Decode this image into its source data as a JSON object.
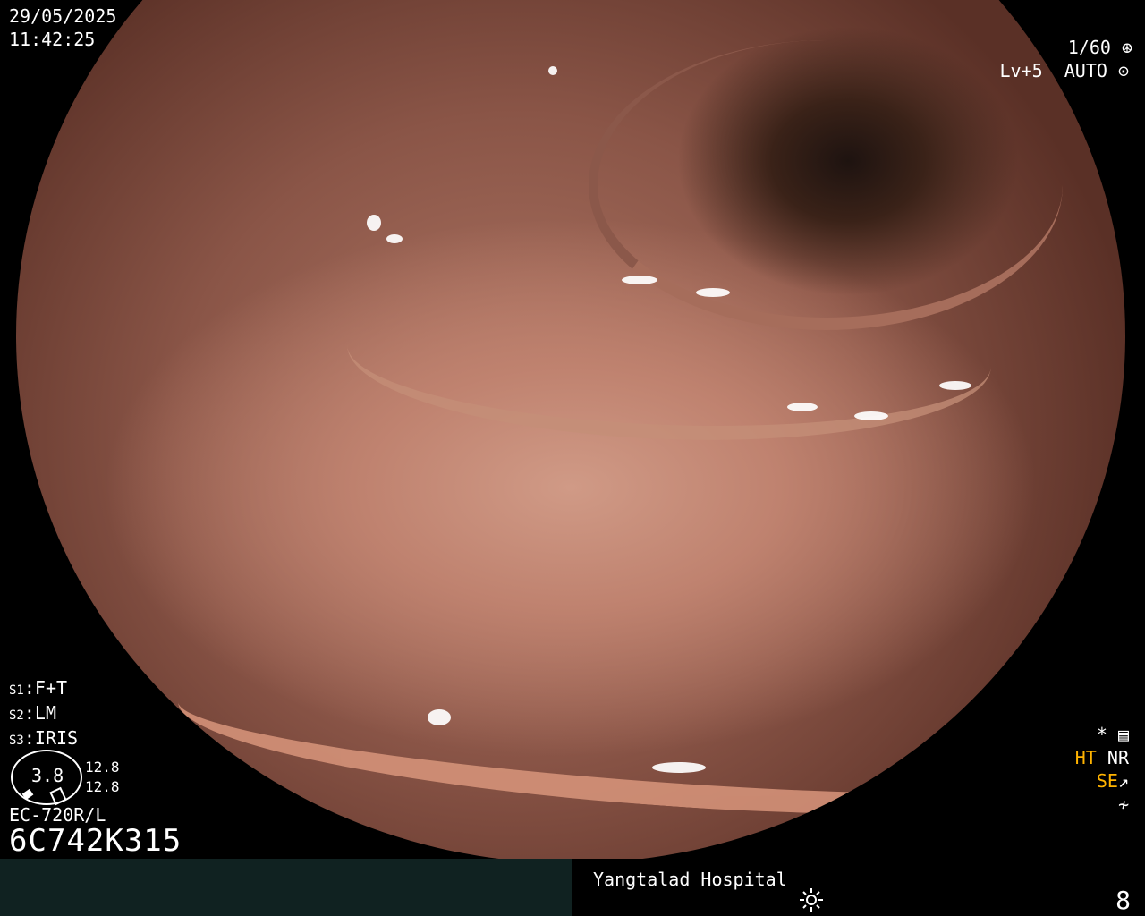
{
  "overlay": {
    "date": "29/05/2025",
    "time": "11:42:25",
    "shutter": "1/60",
    "shutter_icon": "aperture-icon",
    "level": "Lv+5",
    "mode": "AUTO",
    "mode_icon": "iris-icon"
  },
  "left_info": {
    "s1_key": "S1",
    "s1_value": "F+T",
    "s2_key": "S2",
    "s2_value": "LM",
    "s3_key": "S3",
    "s3_value": "IRIS",
    "zoom_value": "3.8",
    "zoom_right1": "12.8",
    "zoom_right2": "12.8",
    "scope_model": "EC-720R/L",
    "serial": "6C742K315"
  },
  "right_panel": {
    "star": "*",
    "ht": "HT",
    "nr": "NR",
    "se": "SE",
    "misc": "≁"
  },
  "footer": {
    "hospital": "Yangtalad Hospital",
    "number": "8"
  }
}
